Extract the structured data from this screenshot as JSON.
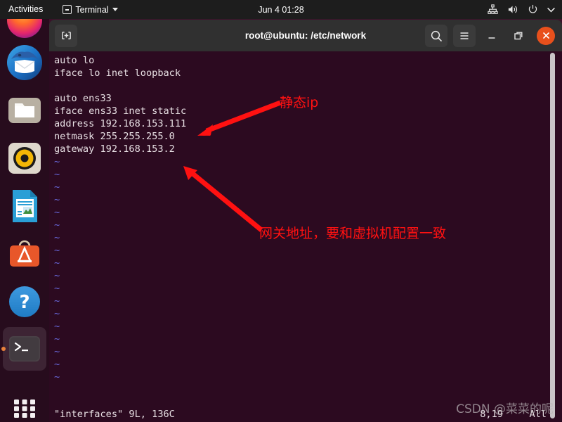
{
  "topbar": {
    "activities": "Activities",
    "app_menu": "Terminal",
    "clock": "Jun 4 01:28",
    "icons": [
      "network-wired-icon",
      "volume-icon",
      "power-icon",
      "caret-down-icon"
    ]
  },
  "dock": {
    "items": [
      {
        "name": "firefox",
        "label": "Firefox"
      },
      {
        "name": "thunderbird",
        "label": "Thunderbird Mail"
      },
      {
        "name": "files",
        "label": "Files"
      },
      {
        "name": "rhythmbox",
        "label": "Rhythmbox"
      },
      {
        "name": "libreoffice-writer",
        "label": "LibreOffice Writer"
      },
      {
        "name": "ubuntu-software",
        "label": "Ubuntu Software"
      },
      {
        "name": "help",
        "label": "Help"
      },
      {
        "name": "terminal",
        "label": "Terminal"
      },
      {
        "name": "show-applications",
        "label": "Show Applications"
      }
    ]
  },
  "window": {
    "title": "root@ubuntu: /etc/network",
    "buttons": {
      "new_tab": "new-tab-button",
      "search": "search-button",
      "menu": "menu-button",
      "minimize": "minimize-button",
      "maximize": "maximize-button",
      "close": "close-button"
    }
  },
  "terminal": {
    "lines": [
      "auto lo",
      "iface lo inet loopback",
      "",
      "auto ens33",
      "iface ens33 inet static",
      "address 192.168.153.111",
      "netmask 255.255.255.0",
      "gateway 192.168.153.2"
    ],
    "tilde_marker": "~",
    "tilde_count": 18,
    "status": {
      "file_info": "\"interfaces\" 9L, 136C",
      "position": "8,19",
      "scroll": "All"
    }
  },
  "annotations": [
    {
      "name": "annotation-static-ip",
      "text": "静态ip",
      "color": "#ff1111"
    },
    {
      "name": "annotation-gateway",
      "text": "网关地址，要和虚拟机配置一致",
      "color": "#ff1111"
    }
  ],
  "watermark": {
    "text": "CSDN @菜菜的呢"
  },
  "colors": {
    "terminal_bg": "#2c0a20",
    "titlebar_bg": "#303030",
    "topbar_bg": "#1d1d1d",
    "accent_close": "#e8501c",
    "annotation_red": "#ff1111",
    "tilde_blue": "#6a6ae0"
  }
}
